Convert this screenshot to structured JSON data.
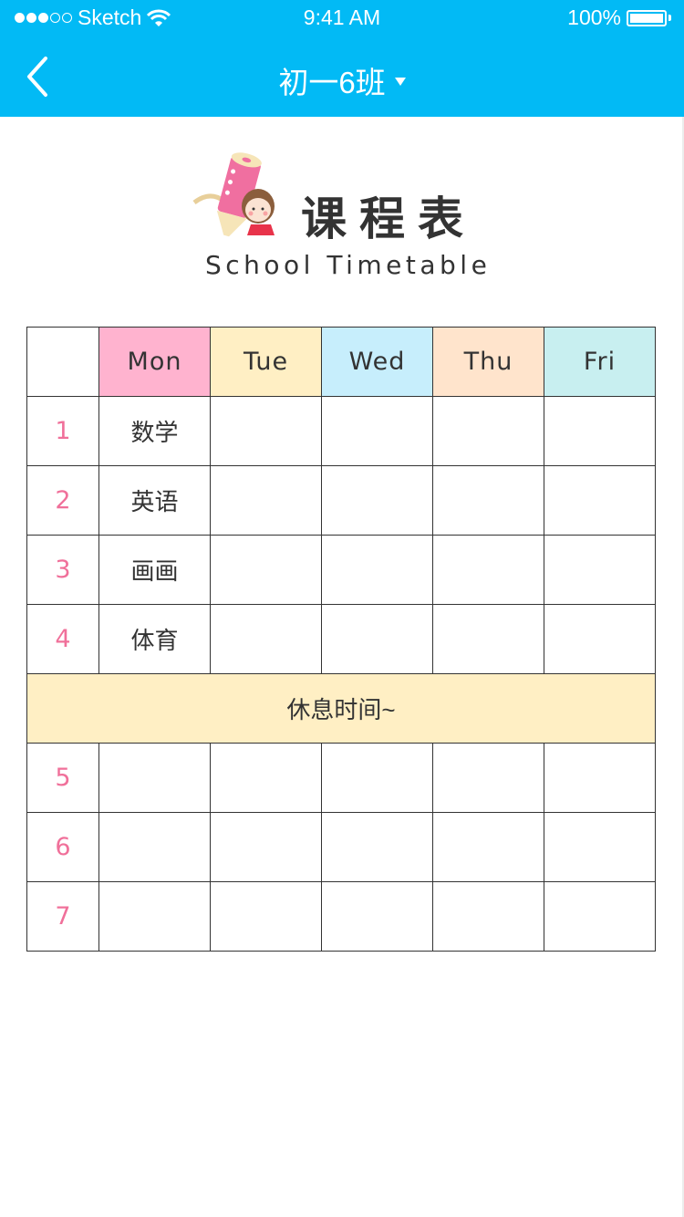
{
  "status_bar": {
    "signal_filled": 3,
    "signal_total": 5,
    "carrier": "Sketch",
    "time": "9:41 AM",
    "battery": "100%"
  },
  "nav": {
    "title": "初一6班",
    "background": "#02BAF5"
  },
  "logo": {
    "title": "课程表",
    "subtitle": "School Timetable"
  },
  "timetable": {
    "days": [
      {
        "label": "Mon",
        "color": "#FFB3CF"
      },
      {
        "label": "Tue",
        "color": "#FFEFC4"
      },
      {
        "label": "Wed",
        "color": "#C7EEFC"
      },
      {
        "label": "Thu",
        "color": "#FFE4CC"
      },
      {
        "label": "Fri",
        "color": "#C8EFF0"
      }
    ],
    "morning": [
      {
        "period": "1",
        "cells": [
          "数学",
          "",
          "",
          "",
          ""
        ]
      },
      {
        "period": "2",
        "cells": [
          "英语",
          "",
          "",
          "",
          ""
        ]
      },
      {
        "period": "3",
        "cells": [
          "画画",
          "",
          "",
          "",
          ""
        ]
      },
      {
        "period": "4",
        "cells": [
          "体育",
          "",
          "",
          "",
          ""
        ]
      }
    ],
    "break_label": "休息时间~",
    "afternoon": [
      {
        "period": "5",
        "cells": [
          "",
          "",
          "",
          "",
          ""
        ]
      },
      {
        "period": "6",
        "cells": [
          "",
          "",
          "",
          "",
          ""
        ]
      },
      {
        "period": "7",
        "cells": [
          "",
          "",
          "",
          "",
          ""
        ]
      }
    ]
  }
}
